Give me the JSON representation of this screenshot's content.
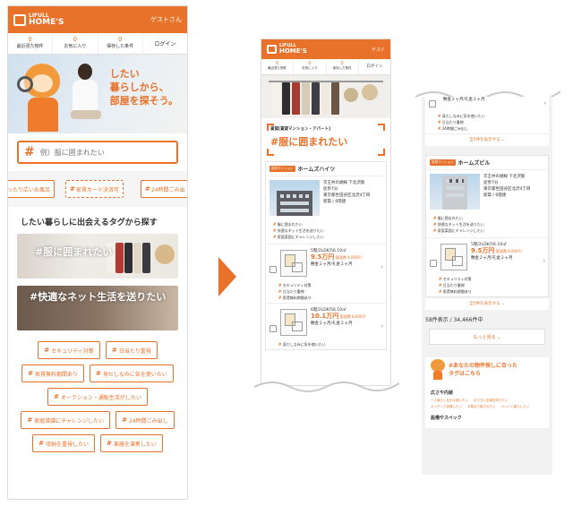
{
  "brand": {
    "logo_top": "LIFULL",
    "logo_bottom": "HOME'S",
    "guest": "ゲストさん",
    "guest_short": "ゲスト"
  },
  "colors": {
    "accent": "#e8722a",
    "text": "#333333",
    "background": "#ffffff"
  },
  "nav": [
    {
      "count": "0",
      "label": "最近見た物件"
    },
    {
      "count": "0",
      "label": "お気に入り"
    },
    {
      "count": "0",
      "label": "保存した条件"
    }
  ],
  "nav_login": "ログイン",
  "hero": {
    "line1": "したい",
    "line2": "暮らしから、",
    "line3": "部屋を探そう。"
  },
  "search": {
    "placeholder": "例）服に囲まれたい",
    "icon": "hash-icon"
  },
  "chips": [
    "ったり広いお風呂",
    "家賃カード決済可",
    "24時間ごみ出"
  ],
  "section_title": "したい暮らしに出会えるタグから探す",
  "banners": [
    "服に囲まれたい",
    "快適なネット生活を送りたい"
  ],
  "tags": [
    "セキュリティ対策",
    "日当たり重視",
    "家賃無料期間あり",
    "身だしなみに気を使いたい",
    "オークション・通販生活がしたい",
    "家庭菜園にチャレンジしたい",
    "24時間ごみ出し",
    "収納を重視したい",
    "楽器を演奏したい"
  ],
  "screen2": {
    "category": "賃貸[賃貸マンション・アパート]",
    "tag_title": "服に囲まれたい",
    "property": {
      "badge": "賃貸マンション",
      "name": "ホームズハイツ",
      "station": "京王井の頭線 下北沢駅",
      "walk": "徒歩7分",
      "address": "東京都世田谷区北沢4丁目",
      "age": "新築 / 6階建",
      "tags": [
        "服に囲まれたい",
        "快適なネット生活を送りたい",
        "家庭菜園にチャレンジしたい"
      ]
    },
    "rooms": [
      {
        "floor": "5階/2LDK/56.10㎡",
        "rent": "9.5万円",
        "fee": "管理費 8,000円",
        "terms": "敷金２ヶ月/礼金２ヶ月",
        "tags": [
          "セキュリティ対策",
          "日当たり重視",
          "家賃無料期間あり"
        ]
      },
      {
        "floor": "6階/2LDK/56.10㎡",
        "rent": "10.1万円",
        "fee": "管理費 8,000円",
        "terms": "敷金２ヶ月/礼金２ヶ月",
        "tags": [
          "身だしなみに気を使いたい"
        ]
      }
    ]
  },
  "screen3": {
    "top_terms": "敷金２ヶ月/礼金２ヶ月",
    "top_tags": [
      "身だしなみに気を使いたい",
      "日当たり重視",
      "24時間ごみ出し"
    ],
    "show_all": "全5件を表示する",
    "property": {
      "badge": "賃貸マンション",
      "name": "ホームズビル",
      "station": "京王井の頭線 下北沢駅",
      "walk": "徒歩7分",
      "address": "東京都世田谷区北沢4丁目",
      "age": "新築 / 6階建",
      "tags": [
        "服に囲まれたい",
        "快適なネット生活を送りたい",
        "家庭菜園にチャレンジしたい"
      ]
    },
    "room": {
      "floor": "5階/2LDK/56.10㎡",
      "rent": "9.5万円",
      "fee": "管理費 8,000円",
      "terms": "敷金２ヶ月/礼金２ヶ月",
      "tags": [
        "セキュリティ対策",
        "日当たり重視",
        "家賃無料期間あり"
      ]
    },
    "count": "58件表示 / 34,466件中",
    "more": "もっと見る",
    "promo": "あなたの物件探しに合ったタグはこちら",
    "promo_line1": "あなたの物件探しに合った",
    "promo_line2": "タグはこちら",
    "sub1": "広さや内装",
    "sub1_items": [
      "一人暮らしを広々使いたい",
      "おうちに友達を呼びたい",
      "キッチンで自慢したい",
      "お風呂で癒されたい",
      "ペットと暮らしたい"
    ],
    "sub2": "設備やスペック"
  }
}
